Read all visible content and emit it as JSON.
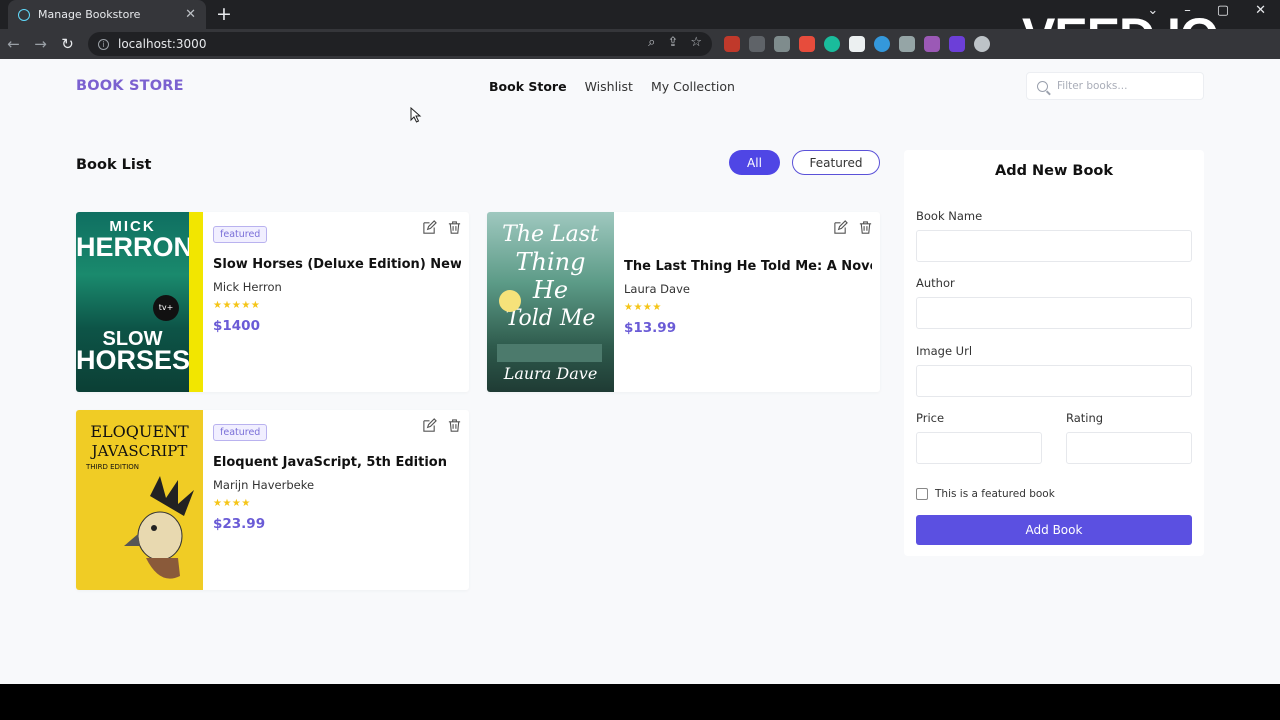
{
  "browser": {
    "tab_title": "Manage Bookstore",
    "url": "localhost:3000"
  },
  "watermark": "VEED.IO",
  "app": {
    "brand": "BOOK STORE",
    "nav": [
      "Book Store",
      "Wishlist",
      "My Collection"
    ],
    "search_placeholder": "Filter books..."
  },
  "book_list": {
    "title": "Book List",
    "filters": {
      "all": "All",
      "featured": "Featured"
    },
    "books": [
      {
        "featured_badge": "featured",
        "title": "Slow Horses (Deluxe Edition) New",
        "author": "Mick Herron",
        "rating": 5,
        "stars": "★★★★★",
        "price": "$1400",
        "cover": {
          "top": "MICK",
          "name": "HERRON",
          "sub1": "SLOW",
          "sub2": "HORSES",
          "tag": "tv+"
        }
      },
      {
        "featured_badge": "",
        "title": "The Last Thing He Told Me: A Novel",
        "author": "Laura Dave",
        "rating": 4,
        "stars": "★★★★",
        "price": "$13.99",
        "cover": {
          "line1": "The Last",
          "line2": "Thing",
          "line3": "He",
          "line4": "Told Me",
          "author": "Laura Dave"
        }
      },
      {
        "featured_badge": "featured",
        "title": "Eloquent JavaScript, 5th Edition",
        "author": "Marijn Haverbeke",
        "rating": 4,
        "stars": "★★★★",
        "price": "$23.99",
        "cover": {
          "line1": "ELOQUENT",
          "line2": "JAVASCRIPT",
          "edition": "THIRD EDITION"
        }
      }
    ]
  },
  "form": {
    "title": "Add New Book",
    "book_name_label": "Book Name",
    "author_label": "Author",
    "image_url_label": "Image Url",
    "price_label": "Price",
    "rating_label": "Rating",
    "featured_checkbox_label": "This is a featured book",
    "submit_label": "Add Book"
  },
  "colors": {
    "accent": "#4f46e5",
    "brand": "#7b61d0",
    "star": "#f5c518"
  }
}
